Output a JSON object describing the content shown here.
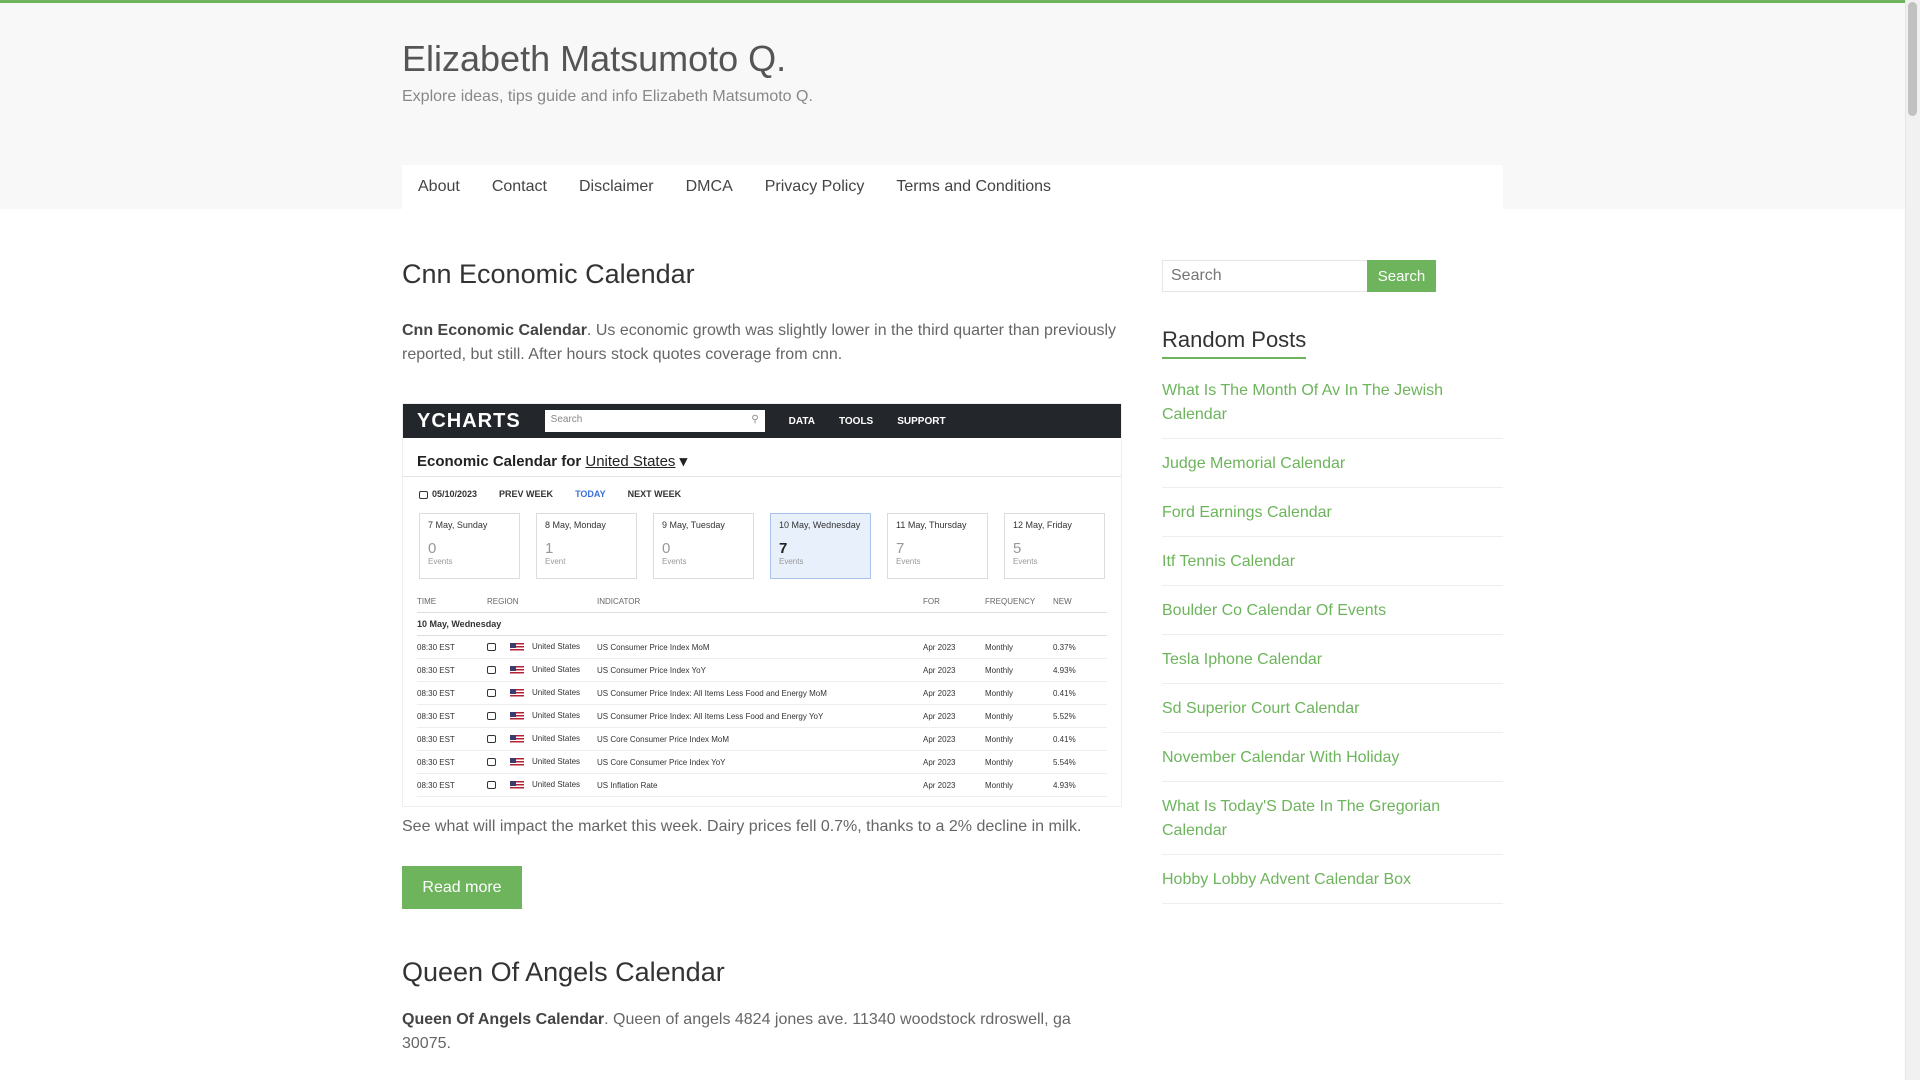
{
  "site": {
    "title": "Elizabeth Matsumoto Q.",
    "description": "Explore ideas, tips guide and info Elizabeth Matsumoto Q.",
    "accent_color": "#6db45c"
  },
  "nav": {
    "items": [
      "About",
      "Contact",
      "Disclaimer",
      "DMCA",
      "Privacy Policy",
      "Terms and Conditions"
    ]
  },
  "posts": [
    {
      "title": "Cnn Economic Calendar",
      "excerpt_bold": "Cnn Economic Calendar",
      "excerpt_text": ". Us economic growth was slightly lower in the third quarter than previously reported, but still. After hours stock quotes coverage from cnn.",
      "caption": "See what will impact the market this week. Dairy prices fell 0.7%, thanks to a 2% decline in milk.",
      "read_more": "Read more",
      "image": {
        "logo": "YCHARTS",
        "search_placeholder": "Search",
        "menu": [
          "DATA",
          "TOOLS",
          "SUPPORT"
        ],
        "heading_prefix": "Economic Calendar for",
        "heading_country": "United States",
        "week_bar": [
          "05/10/2023",
          "PREV WEEK",
          "TODAY",
          "NEXT WEEK"
        ],
        "days": [
          {
            "label": "7 May, Sunday",
            "count": "0",
            "unit": "Events"
          },
          {
            "label": "8 May, Monday",
            "count": "1",
            "unit": "Event"
          },
          {
            "label": "9 May, Tuesday",
            "count": "0",
            "unit": "Events"
          },
          {
            "label": "10 May, Wednesday",
            "count": "7",
            "unit": "Events"
          },
          {
            "label": "11 May, Thursday",
            "count": "7",
            "unit": "Events"
          },
          {
            "label": "12 May, Friday",
            "count": "5",
            "unit": "Events"
          }
        ],
        "columns": [
          "TIME",
          "REGION",
          "INDICATOR",
          "FOR",
          "FREQUENCY",
          "NEW"
        ],
        "subheading": "10 May, Wednesday",
        "rows": [
          {
            "time": "08:30 EST",
            "region": "United States",
            "indicator": "US Consumer Price Index MoM",
            "for": "Apr 2023",
            "freq": "Monthly",
            "new": "0.37%"
          },
          {
            "time": "08:30 EST",
            "region": "United States",
            "indicator": "US Consumer Price Index YoY",
            "for": "Apr 2023",
            "freq": "Monthly",
            "new": "4.93%"
          },
          {
            "time": "08:30 EST",
            "region": "United States",
            "indicator": "US Consumer Price Index: All Items Less Food and Energy MoM",
            "for": "Apr 2023",
            "freq": "Monthly",
            "new": "0.41%"
          },
          {
            "time": "08:30 EST",
            "region": "United States",
            "indicator": "US Consumer Price Index: All Items Less Food and Energy YoY",
            "for": "Apr 2023",
            "freq": "Monthly",
            "new": "5.52%"
          },
          {
            "time": "08:30 EST",
            "region": "United States",
            "indicator": "US Core Consumer Price Index MoM",
            "for": "Apr 2023",
            "freq": "Monthly",
            "new": "0.41%"
          },
          {
            "time": "08:30 EST",
            "region": "United States",
            "indicator": "US Core Consumer Price Index YoY",
            "for": "Apr 2023",
            "freq": "Monthly",
            "new": "5.54%"
          },
          {
            "time": "08:30 EST",
            "region": "United States",
            "indicator": "US Inflation Rate",
            "for": "Apr 2023",
            "freq": "Monthly",
            "new": "4.93%"
          }
        ]
      }
    },
    {
      "title": "Queen Of Angels Calendar",
      "excerpt_bold": "Queen Of Angels Calendar",
      "excerpt_text": ". Queen of angels 4824 jones ave. 11340 woodstock rdroswell, ga 30075."
    }
  ],
  "sidebar": {
    "search_placeholder": "Search",
    "search_button": "Search",
    "widget_title": "Random Posts",
    "random_posts": [
      "What Is The Month Of Av In The Jewish Calendar",
      "Judge Memorial Calendar",
      "Ford Earnings Calendar",
      "Itf Tennis Calendar",
      "Boulder Co Calendar Of Events",
      "Tesla Iphone Calendar",
      "Sd Superior Court Calendar",
      "November Calendar With Holiday",
      "What Is Today'S Date In The Gregorian Calendar",
      "Hobby Lobby Advent Calendar Box"
    ]
  }
}
